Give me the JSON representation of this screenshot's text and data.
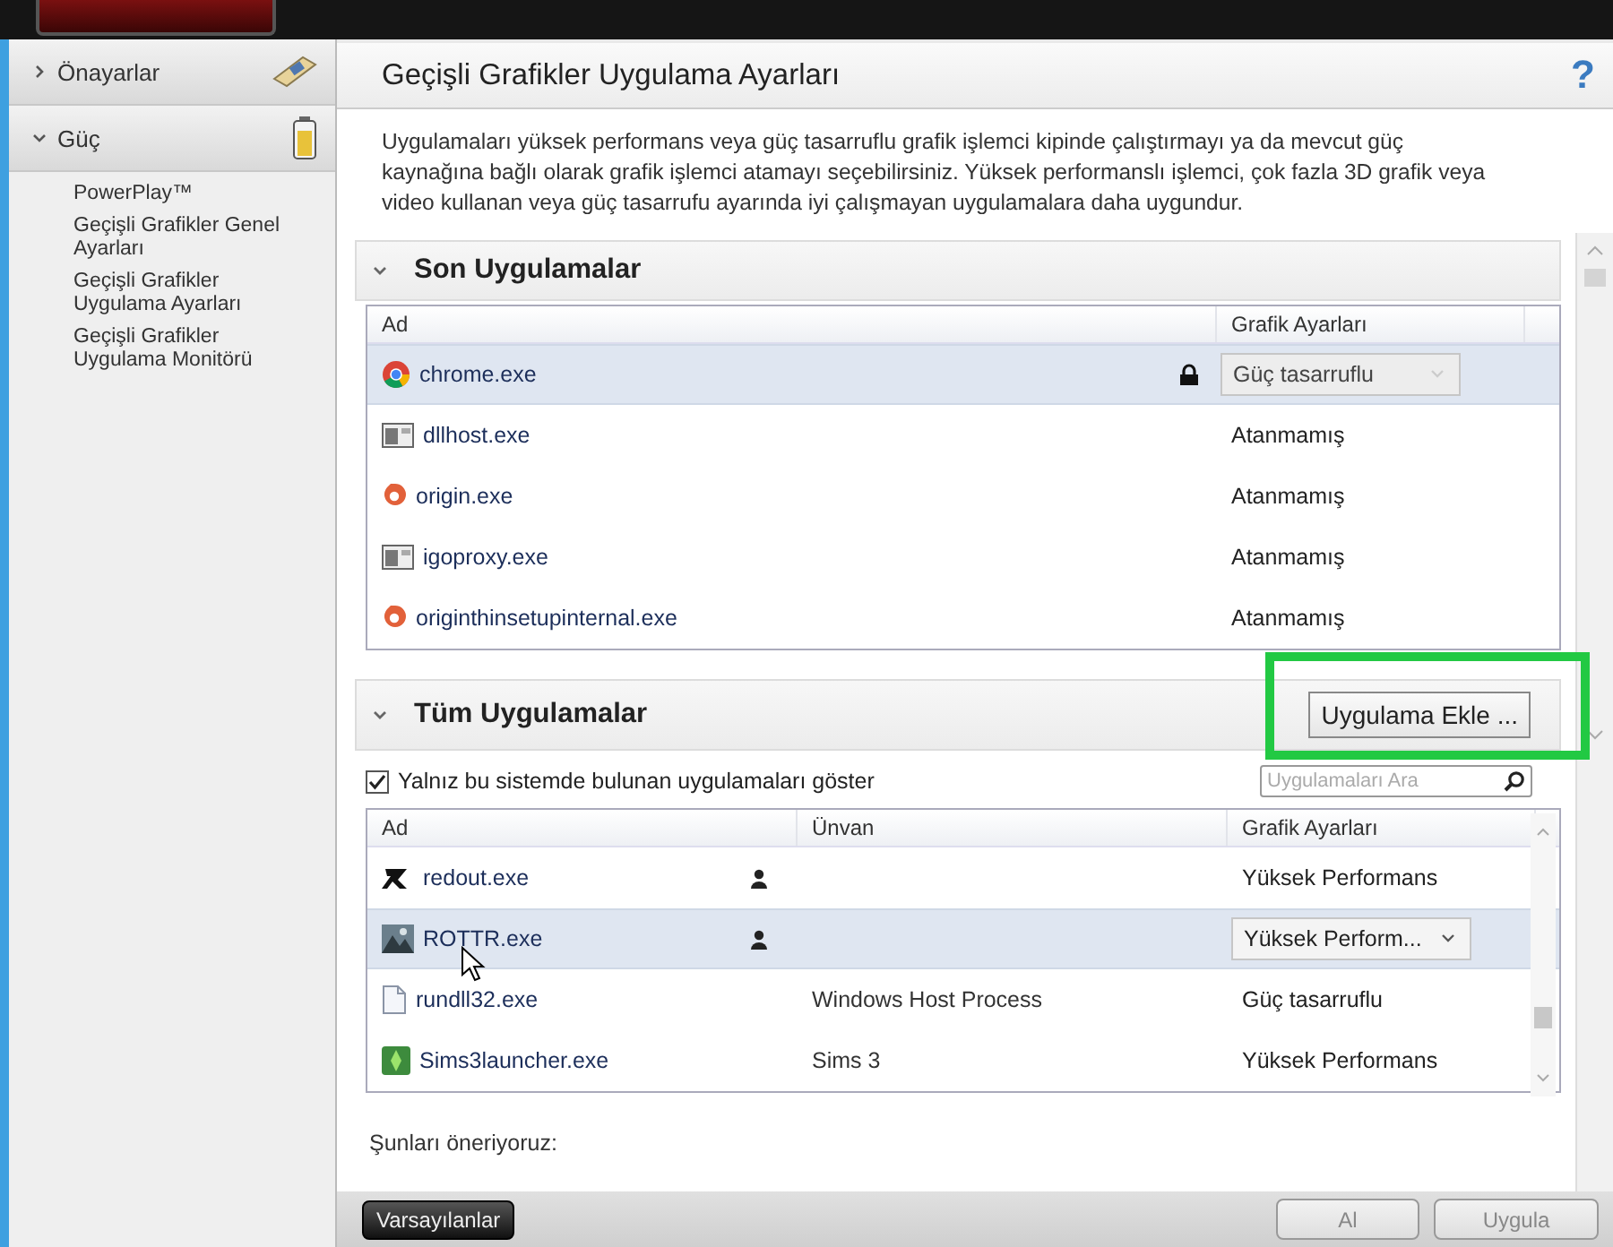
{
  "sidebar": {
    "groups": [
      {
        "label": "Önayarlar",
        "expanded": false,
        "kind": "card"
      },
      {
        "label": "Güç",
        "expanded": true,
        "kind": "battery",
        "items": [
          {
            "label": "PowerPlay™"
          },
          {
            "label": "Geçişli Grafikler Genel Ayarları"
          },
          {
            "label": "Geçişli Grafikler Uygulama Ayarları"
          },
          {
            "label": "Geçişli Grafikler Uygulama Monitörü"
          }
        ]
      }
    ]
  },
  "page": {
    "title": "Geçişli Grafikler Uygulama Ayarları",
    "help": "?",
    "description": "Uygulamaları yüksek performans veya güç tasarruflu grafik işlemci kipinde çalıştırmayı ya da mevcut güç kaynağına bağlı olarak grafik işlemci atamayı seçebilirsiniz. Yüksek performanslı işlemci, çok fazla 3D grafik veya video kullanan veya güç tasarrufu ayarında iyi çalışmayan uygulamalara daha uygundur."
  },
  "recent": {
    "title": "Son Uygulamalar",
    "expanded": true,
    "columns": [
      "Ad",
      "Grafik Ayarları"
    ],
    "rows": [
      {
        "name": "chrome.exe",
        "kind": "chrome",
        "locked": true,
        "setting": "Güç tasarruflu",
        "selected": true
      },
      {
        "name": "dllhost.exe",
        "kind": "window",
        "locked": false,
        "setting": "Atanmamış",
        "selected": false
      },
      {
        "name": "origin.exe",
        "kind": "origin",
        "locked": false,
        "setting": "Atanmamış",
        "selected": false
      },
      {
        "name": "igoproxy.exe",
        "kind": "window",
        "locked": false,
        "setting": "Atanmamış",
        "selected": false
      },
      {
        "name": "originthinsetupinternal.exe",
        "kind": "origin",
        "locked": false,
        "setting": "Atanmamış",
        "selected": false
      }
    ]
  },
  "all": {
    "title": "Tüm Uygulamalar",
    "expanded": true,
    "add_button": {
      "label": "Uygulama Ekle ...",
      "highlighted": true
    },
    "show_only_installed": {
      "label": "Yalnız bu sistemde bulunan uygulamaları göster",
      "checked": true
    },
    "search": {
      "placeholder": "Uygulamaları Ara"
    },
    "columns": [
      "Ad",
      "Ünvan",
      "Grafik Ayarları"
    ],
    "rows": [
      {
        "name": "redout.exe",
        "kind": "redout",
        "user": true,
        "setting": "Yüksek Performans",
        "selected": false,
        "hovered": false
      },
      {
        "name": "ROTTR.exe",
        "kind": "game",
        "user": true,
        "setting": "Yüksek Perform...",
        "selected": true,
        "hovered": true
      },
      {
        "name": "rundll32.exe",
        "kind": "file",
        "user": false,
        "title": "Windows Host Process",
        "setting": "Güç tasarruflu",
        "selected": false,
        "hovered": false
      },
      {
        "name": "Sims3launcher.exe",
        "kind": "sims",
        "user": false,
        "title": "Sims 3",
        "setting": "Yüksek Performans",
        "selected": false,
        "hovered": false
      }
    ]
  },
  "suggestions": {
    "title": "Şunları öneriyoruz:"
  },
  "buttons": {
    "defaults": "Varsayılanlar",
    "discard": "Al",
    "apply": "Uygula"
  }
}
